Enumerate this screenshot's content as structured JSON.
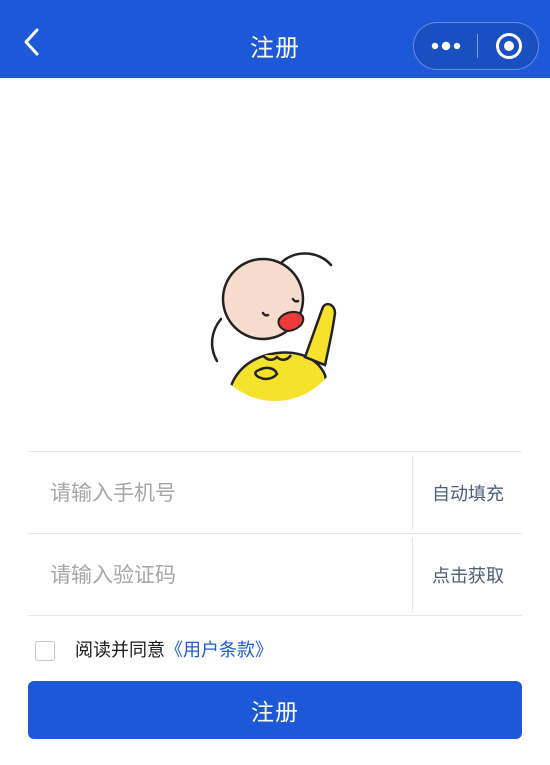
{
  "navbar": {
    "title": "注册",
    "back_icon": "chevron-left-icon",
    "more_icon": "more-dots-icon",
    "close_icon": "target-circle-icon",
    "background": "#1d58d8"
  },
  "avatar": {
    "icon": "cartoon-baby-avatar"
  },
  "form": {
    "phone": {
      "placeholder": "请输入手机号",
      "value": "",
      "action_label": "自动填充"
    },
    "code": {
      "placeholder": "请输入验证码",
      "value": "",
      "action_label": "点击获取"
    }
  },
  "agreement": {
    "checked": false,
    "text": "阅读并同意",
    "link_text": "《用户条款》",
    "link_color": "#1d58d8"
  },
  "submit": {
    "label": "注册",
    "color": "#1d58d8"
  }
}
